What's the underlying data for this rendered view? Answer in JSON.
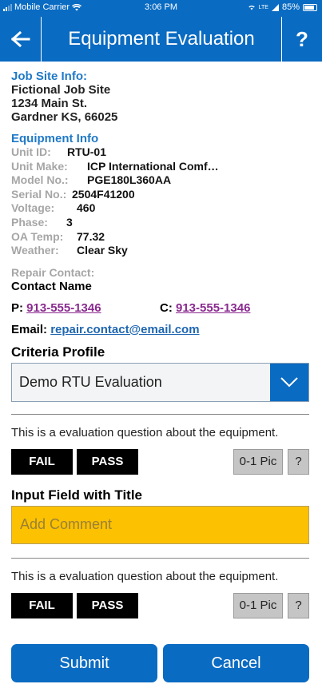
{
  "status_bar": {
    "carrier": "Mobile Carrier",
    "time": "3:06 PM",
    "battery": "85%",
    "network_label": "LTE"
  },
  "header": {
    "title": "Equipment Evaluation",
    "help_label": "?"
  },
  "job_site": {
    "heading": "Job Site Info:",
    "name": "Fictional Job Site",
    "street": "1234 Main St.",
    "city_line": "Gardner KS, 66025"
  },
  "equipment": {
    "heading": "Equipment Info",
    "fields": [
      {
        "label": "Unit ID:",
        "value": "RTU-01"
      },
      {
        "label": "Unit Make:",
        "value": "ICP International Comf…"
      },
      {
        "label": "Model No.:",
        "value": "PGE180L360AA"
      },
      {
        "label": "Serial No.:",
        "value": "2504F41200"
      },
      {
        "label": "Voltage:",
        "value": "460"
      },
      {
        "label": "Phase:",
        "value": "3"
      },
      {
        "label": "OA Temp:",
        "value": "77.32"
      },
      {
        "label": "Weather:",
        "value": "Clear Sky"
      }
    ]
  },
  "repair": {
    "label": "Repair Contact:",
    "name": "Contact Name",
    "phone_label": "P:",
    "phone": "913-555-1346",
    "cell_label": "C:",
    "cell": "913-555-1346",
    "email_label": "Email:",
    "email": "repair.contact@email.com"
  },
  "criteria": {
    "heading": "Criteria Profile",
    "selected": "Demo RTU Evaluation"
  },
  "questions": [
    {
      "text": "This is a evaluation question about the equipment.",
      "fail": "FAIL",
      "pass": "PASS",
      "pic": "0-1 Pic",
      "help": "?"
    },
    {
      "text": "This is a evaluation question about the equipment.",
      "fail": "FAIL",
      "pass": "PASS",
      "pic": "0-1 Pic",
      "help": "?"
    }
  ],
  "input_field": {
    "title": "Input Field with Title",
    "placeholder": "Add Comment",
    "value": ""
  },
  "actions": {
    "submit": "Submit",
    "cancel": "Cancel"
  },
  "colors": {
    "brand_blue": "#0a6bc2",
    "comment_yellow": "#fcc100",
    "link_purple": "#8a2a8f",
    "label_gray": "#a6a6a6"
  }
}
